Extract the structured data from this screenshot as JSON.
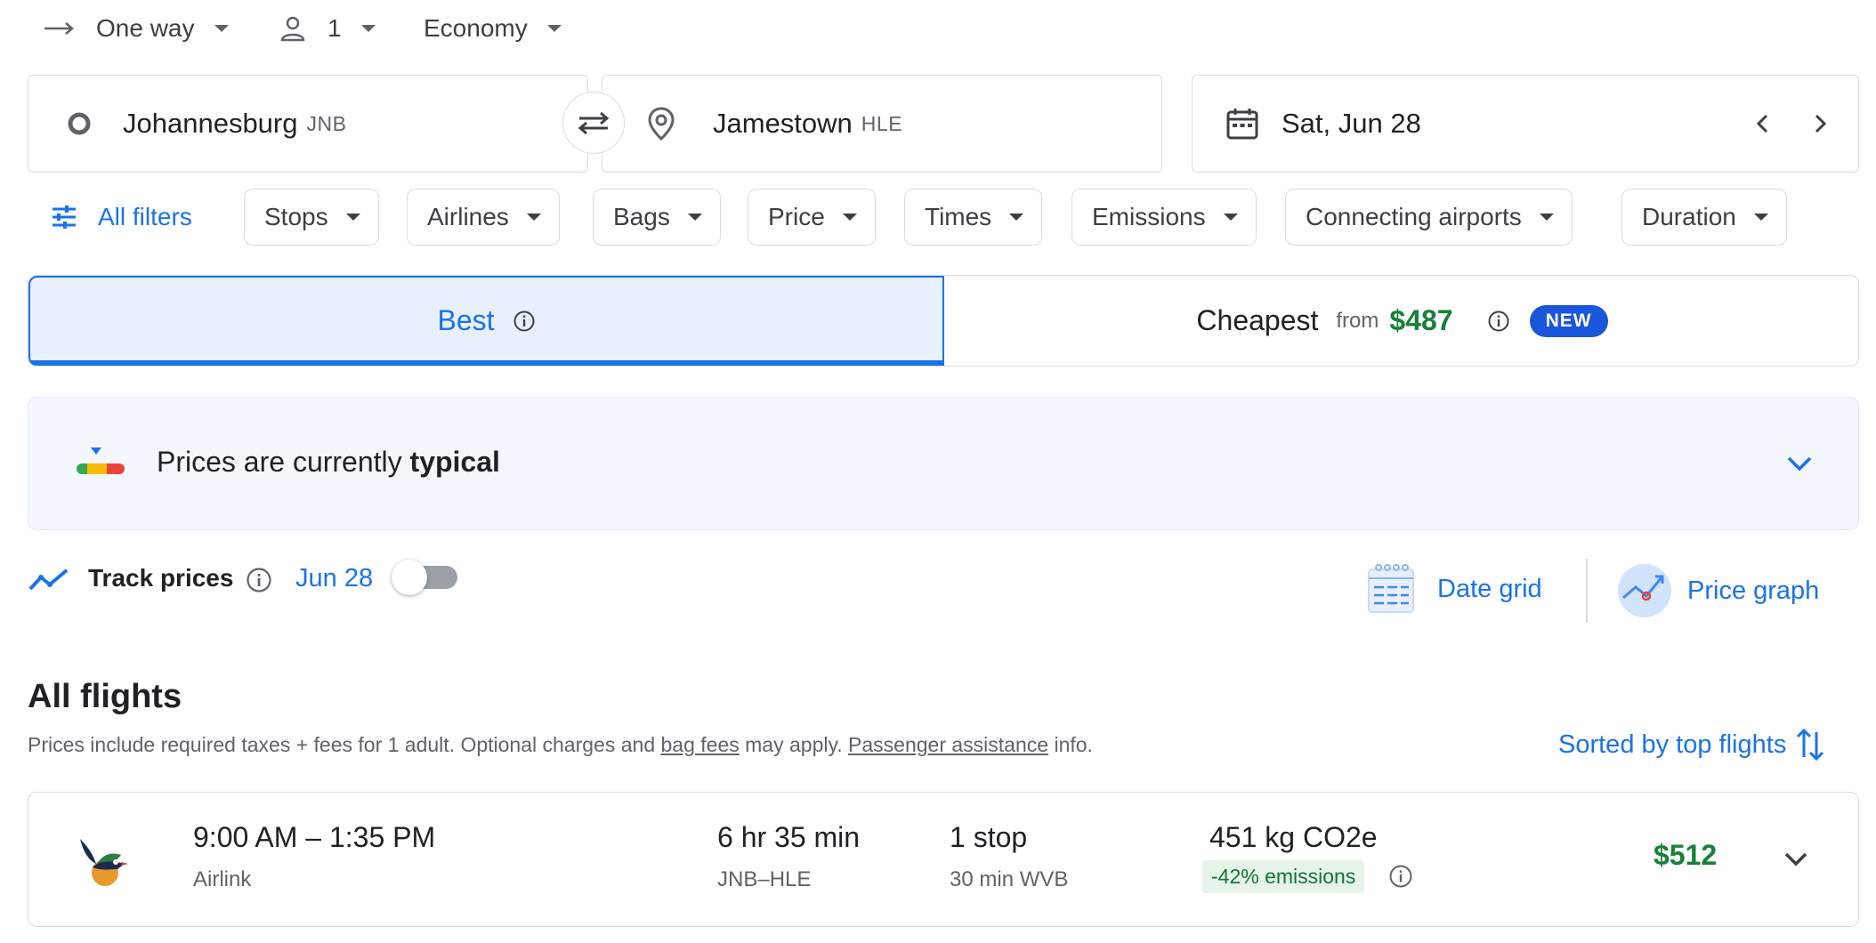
{
  "trip_options": {
    "trip_type": "One way",
    "passengers": "1",
    "cabin_class": "Economy"
  },
  "search": {
    "origin_city": "Johannesburg",
    "origin_code": "JNB",
    "destination_city": "Jamestown",
    "destination_code": "HLE",
    "date": "Sat, Jun 28"
  },
  "filters": {
    "all_filters_label": "All filters",
    "chips": [
      "Stops",
      "Airlines",
      "Bags",
      "Price",
      "Times",
      "Emissions",
      "Connecting airports",
      "Duration"
    ]
  },
  "sort_tabs": {
    "best_label": "Best",
    "cheapest_label": "Cheapest",
    "cheapest_from_label": "from",
    "cheapest_price": "$487",
    "new_badge": "NEW"
  },
  "price_insight": {
    "text_prefix": "Prices are currently",
    "text_emphasis": "typical"
  },
  "tracking": {
    "label": "Track prices",
    "date": "Jun 28",
    "enabled": false,
    "date_grid_label": "Date grid",
    "price_graph_label": "Price graph"
  },
  "results": {
    "heading": "All flights",
    "disclaimer_part1": "Prices include required taxes + fees for 1 adult. Optional charges and",
    "bag_fees_link": "bag fees",
    "disclaimer_part2": "may apply.",
    "passenger_assistance_link": "Passenger assistance",
    "disclaimer_part3": "info.",
    "sort_label": "Sorted by top flights"
  },
  "flights": [
    {
      "times": "9:00 AM – 1:35 PM",
      "airline": "Airlink",
      "duration": "6 hr 35 min",
      "route": "JNB–HLE",
      "stops": "1 stop",
      "layover": "30 min WVB",
      "emissions": "451 kg CO2e",
      "emissions_delta": "-42% emissions",
      "price": "$512"
    }
  ],
  "colors": {
    "accent": "#1a73e8",
    "price_green": "#188038",
    "emissions_badge_bg": "#e6f4ea"
  }
}
